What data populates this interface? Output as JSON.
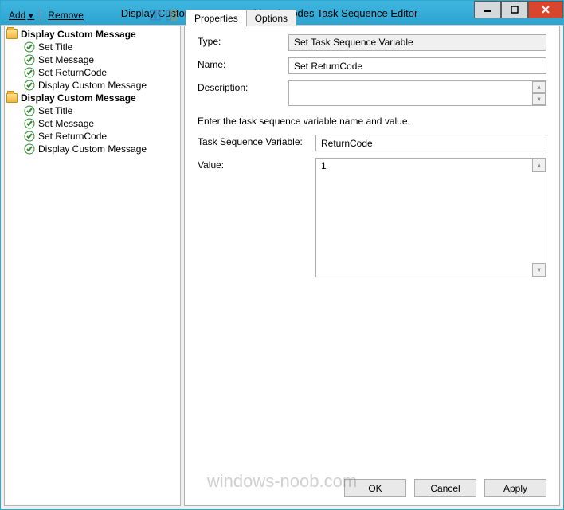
{
  "window": {
    "title": "Display Custom Messages with exit codes Task Sequence Editor"
  },
  "toolbar": {
    "add_label": "Add",
    "remove_label": "Remove"
  },
  "tree": {
    "groups": [
      {
        "label": "Display Custom Message",
        "items": [
          "Set Title",
          "Set Message",
          "Set ReturnCode",
          "Display Custom Message"
        ]
      },
      {
        "label": "Display Custom Message",
        "items": [
          "Set Title",
          "Set Message",
          "Set ReturnCode",
          "Display Custom Message"
        ]
      }
    ]
  },
  "tabs": {
    "properties": "Properties",
    "options": "Options"
  },
  "form": {
    "type_label": "Type:",
    "type_value": "Set Task Sequence Variable",
    "name_label_pre": "N",
    "name_label_post": "ame:",
    "name_value": "Set ReturnCode",
    "desc_label_pre": "D",
    "desc_label_post": "escription:",
    "desc_value": "",
    "instruction": "Enter the task sequence variable name and value.",
    "tsv_label": "Task Sequence Variable:",
    "tsv_value": "ReturnCode",
    "value_label": "Value:",
    "value_value": "1"
  },
  "buttons": {
    "ok": "OK",
    "cancel": "Cancel",
    "apply": "Apply"
  },
  "watermark": "windows-noob.com"
}
